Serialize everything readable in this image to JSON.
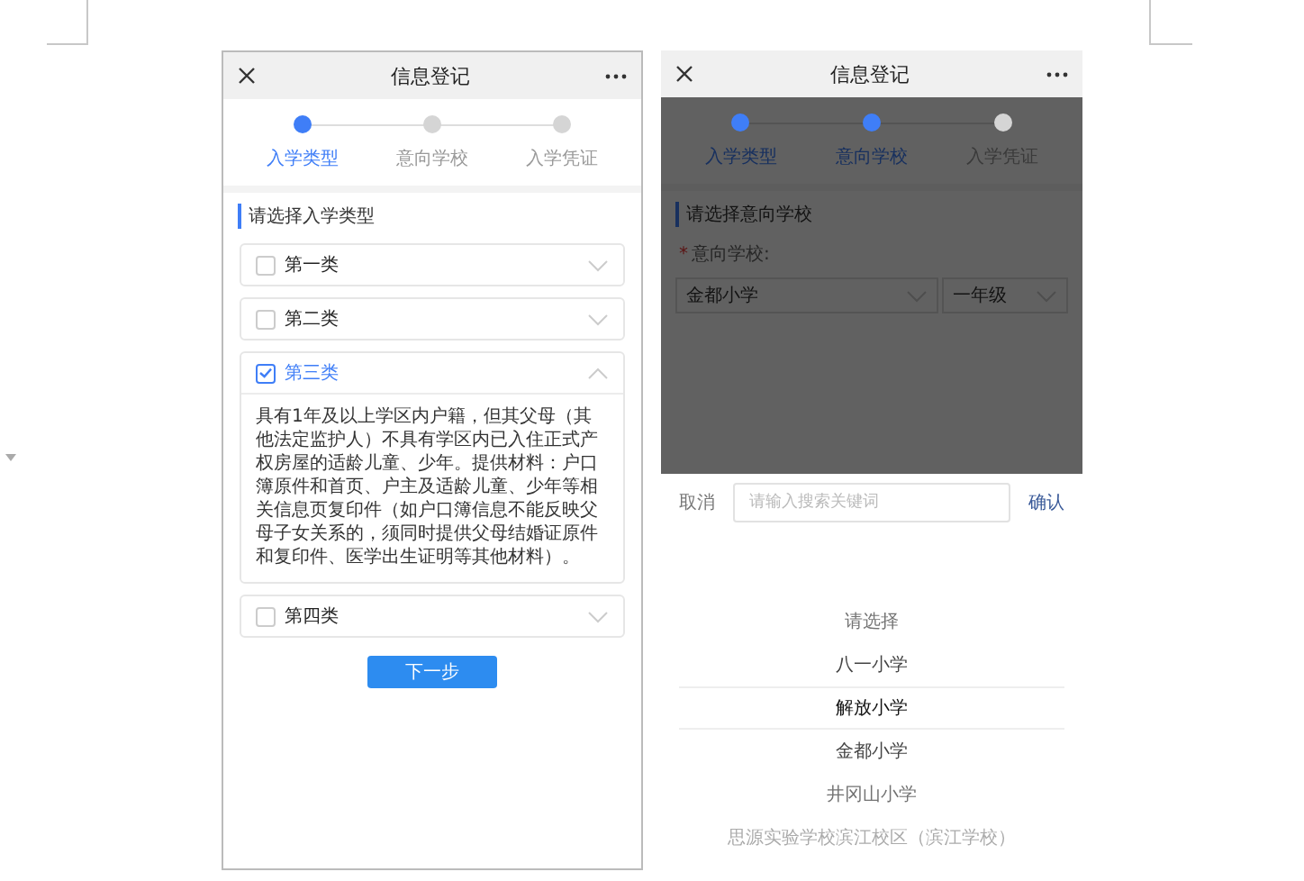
{
  "left_screen": {
    "title": "信息登记",
    "steps": [
      {
        "label": "入学类型",
        "active": true
      },
      {
        "label": "意向学校",
        "active": false
      },
      {
        "label": "入学凭证",
        "active": false
      }
    ],
    "section_title": "请选择入学类型",
    "categories": [
      {
        "label": "第一类",
        "checked": false,
        "expanded": false
      },
      {
        "label": "第二类",
        "checked": false,
        "expanded": false
      },
      {
        "label": "第三类",
        "checked": true,
        "expanded": true,
        "description": "具有1年及以上学区内户籍，但其父母（其他法定监护人）不具有学区内已入住正式产权房屋的适龄儿童、少年。提供材料：户口簿原件和首页、户主及适龄儿童、少年等相关信息页复印件（如户口簿信息不能反映父母子女关系的，须同时提供父母结婚证原件和复印件、医学出生证明等其他材料）。"
      },
      {
        "label": "第四类",
        "checked": false,
        "expanded": false
      }
    ],
    "next_button": "下一步"
  },
  "right_screen": {
    "title": "信息登记",
    "steps": [
      {
        "label": "入学类型",
        "active": true
      },
      {
        "label": "意向学校",
        "active": true
      },
      {
        "label": "入学凭证",
        "active": false
      }
    ],
    "section_title": "请选择意向学校",
    "field_label": "意向学校:",
    "required_mark": "*",
    "selects": [
      "金都小学",
      "一年级"
    ],
    "picker": {
      "cancel": "取消",
      "placeholder": "请输入搜索关键词",
      "confirm": "确认",
      "options": [
        {
          "label": "请选择",
          "selected": false
        },
        {
          "label": "八一小学",
          "selected": false
        },
        {
          "label": "解放小学",
          "selected": true
        },
        {
          "label": "金都小学",
          "selected": false
        },
        {
          "label": "井冈山小学",
          "selected": false
        },
        {
          "label": "思源实验学校滨江校区（滨江学校）",
          "selected": false
        }
      ]
    }
  }
}
